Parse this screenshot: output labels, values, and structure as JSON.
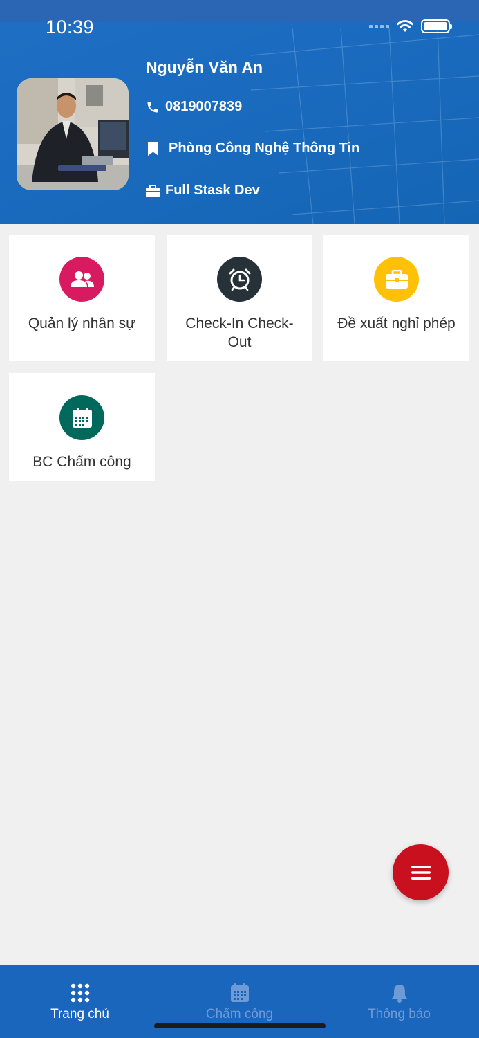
{
  "status_bar": {
    "time": "10:39"
  },
  "profile": {
    "name": "Nguyễn Văn An",
    "phone": "0819007839",
    "department": "Phòng Công Nghệ Thông Tin",
    "position": "Full Stask Dev"
  },
  "tiles": [
    {
      "label": "Quản lý nhân sự",
      "icon": "people-icon",
      "color": "#d81b60"
    },
    {
      "label": "Check-In Check-Out",
      "icon": "alarm-clock-icon",
      "color": "#263238"
    },
    {
      "label": "Đề xuất nghỉ phép",
      "icon": "briefcase-icon",
      "color": "#ffc107"
    },
    {
      "label": "BC Chấm công",
      "icon": "calendar-icon",
      "color": "#00695c"
    }
  ],
  "fab": {
    "icon": "menu-icon",
    "color": "#c8101e"
  },
  "bottom_nav": [
    {
      "label": "Trang chủ",
      "icon": "grid-icon",
      "active": true
    },
    {
      "label": "Chấm công",
      "icon": "calendar-icon",
      "active": false
    },
    {
      "label": "Thông báo",
      "icon": "bell-icon",
      "active": false
    }
  ],
  "colors": {
    "header_blue": "#1a6bbf",
    "nav_blue": "#1a66bd",
    "background": "#f0f0f0"
  }
}
